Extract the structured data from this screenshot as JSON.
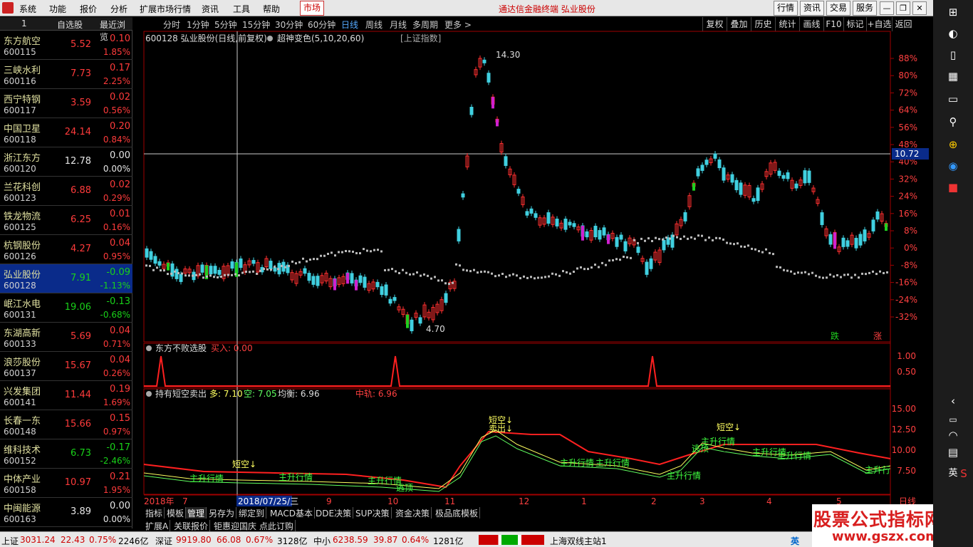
{
  "menu": {
    "items": [
      "系统",
      "功能",
      "报价",
      "分析",
      "扩展市场行情",
      "资讯",
      "工具",
      "帮助"
    ],
    "market": "市场",
    "title": "通达信金融终端  弘业股份",
    "right_buttons": [
      "行情",
      "资讯",
      "交易",
      "服务"
    ]
  },
  "stock_list": {
    "header_index": "1",
    "header_tabs": [
      "自选股",
      "最近浏览"
    ],
    "items": [
      {
        "name": "东方航空",
        "code": "600115",
        "price": "5.52",
        "change": "0.10",
        "pct": "1.85%",
        "dir": "up"
      },
      {
        "name": "三峡水利",
        "code": "600116",
        "price": "7.73",
        "change": "0.17",
        "pct": "2.25%",
        "dir": "up"
      },
      {
        "name": "西宁特钢",
        "code": "600117",
        "price": "3.59",
        "change": "0.02",
        "pct": "0.56%",
        "dir": "up"
      },
      {
        "name": "中国卫星",
        "code": "600118",
        "price": "24.14",
        "change": "0.20",
        "pct": "0.84%",
        "dir": "up"
      },
      {
        "name": "浙江东方",
        "code": "600120",
        "price": "12.78",
        "change": "0.00",
        "pct": "0.00%",
        "dir": "fl"
      },
      {
        "name": "兰花科创",
        "code": "600123",
        "price": "6.88",
        "change": "0.02",
        "pct": "0.29%",
        "dir": "up"
      },
      {
        "name": "铁龙物流",
        "code": "600125",
        "price": "6.25",
        "change": "0.01",
        "pct": "0.16%",
        "dir": "up"
      },
      {
        "name": "杭钢股份",
        "code": "600126",
        "price": "4.27",
        "change": "0.04",
        "pct": "0.95%",
        "dir": "up"
      },
      {
        "name": "弘业股份",
        "code": "600128",
        "price": "7.91",
        "change": "-0.09",
        "pct": "-1.13%",
        "dir": "dn"
      },
      {
        "name": "岷江水电",
        "code": "600131",
        "price": "19.06",
        "change": "-0.13",
        "pct": "-0.68%",
        "dir": "dn"
      },
      {
        "name": "东湖高新",
        "code": "600133",
        "price": "5.69",
        "change": "0.04",
        "pct": "0.71%",
        "dir": "up"
      },
      {
        "name": "浪莎股份",
        "code": "600137",
        "price": "15.67",
        "change": "0.04",
        "pct": "0.26%",
        "dir": "up"
      },
      {
        "name": "兴发集团",
        "code": "600141",
        "price": "11.44",
        "change": "0.19",
        "pct": "1.69%",
        "dir": "up"
      },
      {
        "name": "长春一东",
        "code": "600148",
        "price": "15.66",
        "change": "0.15",
        "pct": "0.97%",
        "dir": "up"
      },
      {
        "name": "维科技术",
        "code": "600152",
        "price": "6.73",
        "change": "-0.17",
        "pct": "-2.46%",
        "dir": "dn"
      },
      {
        "name": "中体产业",
        "code": "600158",
        "price": "10.97",
        "change": "0.21",
        "pct": "1.95%",
        "dir": "up"
      },
      {
        "name": "中闽能源",
        "code": "600163",
        "price": "3.89",
        "change": "0.00",
        "pct": "0.00%",
        "dir": "fl"
      }
    ]
  },
  "chart": {
    "header": "600128 弘业股份(日线,前复权)",
    "indicator": "超神变色(5,10,20,60)",
    "index_label": "[上证指数]",
    "periods": [
      "分时",
      "1分钟",
      "5分钟",
      "15分钟",
      "30分钟",
      "60分钟",
      "日线",
      "周线",
      "月线",
      "多周期",
      "更多 >"
    ],
    "active_period": "日线",
    "toolbar_right": [
      "复权",
      "叠加",
      "历史",
      "统计",
      "画线",
      "F10",
      "标记",
      "+自选",
      "返回"
    ],
    "high_label": "14.30",
    "low_label": "4.70",
    "crosshair_value": "10.72",
    "y_axis": [
      "88%",
      "80%",
      "72%",
      "64%",
      "56%",
      "48%",
      "40%",
      "32%",
      "24%",
      "16%",
      "8%",
      "0%",
      "-8%",
      "-16%",
      "-24%",
      "-32%"
    ],
    "signal_up": "跌",
    "signal_dn": "涨",
    "panel2_title": "东方不败选股",
    "panel2_buy": "买入: 0.00",
    "panel2_axis": [
      "1.00",
      "0.50"
    ],
    "panel3_title": "持有短空卖出",
    "panel3_duo": "多: 7.10",
    "panel3_kong": "空: 7.05",
    "panel3_jh": "均衡: 6.96",
    "panel3_zg": "中轨: 6.96",
    "panel3_axis": [
      "15.00",
      "12.50",
      "10.00",
      "7.50"
    ],
    "panel3_labels": [
      "短空↓",
      "主升行情",
      "主升行情",
      "主升行情",
      "逃顶",
      "短空↓",
      "卖出↓",
      "主升行情",
      "主升行情",
      "主升行情",
      "逃顶",
      "短空↓",
      "主升行情",
      "主升行情",
      "主升行情",
      "主升行"
    ],
    "x_axis": [
      "2018年",
      "7",
      "2018/07/25/三",
      "9",
      "10",
      "11",
      "12",
      "1",
      "2",
      "3",
      "4",
      "5",
      "日线"
    ]
  },
  "bottom_tabs": [
    "指标",
    "模板",
    "管理",
    "另存为",
    "绑定到",
    "MACD基本",
    "DDE决策",
    "SUP决策",
    "资金决策",
    "极品底模板"
  ],
  "bottom_tabs_active": "管理",
  "bottom_tabs2": [
    "扩展A",
    "关联报价",
    "钜惠迎国庆 点此订购"
  ],
  "status": {
    "sh_label": "上证",
    "sh_val": "3031.24",
    "sh_chg": "22.43",
    "sh_pct": "0.75%",
    "sh_amt": "2246亿",
    "sz_label": "深证",
    "sz_val": "9919.80",
    "sz_chg": "66.08",
    "sz_pct": "0.67%",
    "sz_amt": "3128亿",
    "zx_label": "中小",
    "zx_val": "6238.59",
    "zx_chg": "39.87",
    "zx_pct": "0.64%",
    "zx_amt": "1281亿",
    "server": "上海双线主站1",
    "ime": "英"
  },
  "watermark": {
    "title": "股票公式指标网",
    "url": "www.gszx.com.cn"
  },
  "colors": {
    "up": "#ff3b3b",
    "down": "#19d219",
    "grid": "#8b0000",
    "magenta": "#d020d0",
    "cyan": "#5fd7e8"
  }
}
